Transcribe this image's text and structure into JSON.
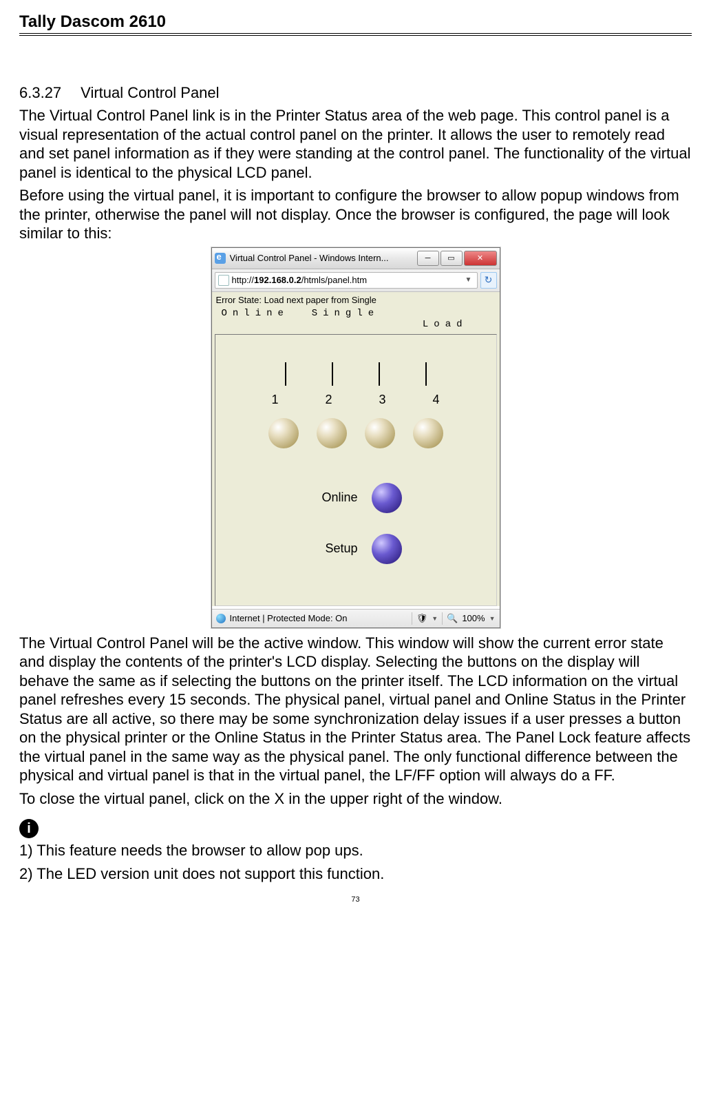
{
  "header": {
    "title": "Tally Dascom 2610"
  },
  "section": {
    "number": "6.3.27",
    "title": "Virtual Control Panel"
  },
  "para1": "The Virtual Control Panel link is in the Printer Status area of the web page. This control panel is a visual representation of the actual control panel on the printer. It allows the user to remotely read and set panel information as if they were standing at the control panel. The functionality of the virtual panel is identical to the physical LCD panel.",
  "para2": "Before using the virtual panel, it is important to configure the browser to allow popup windows from the printer, otherwise the panel will not display. Once the browser is configured, the page will look similar to this:",
  "window": {
    "title": "Virtual Control Panel - Windows Intern...",
    "url_prefix": "http://",
    "url_host": "192.168.0.2",
    "url_path": "/htmls/panel.htm",
    "error_state": "Error State: Load next paper from Single",
    "lcd_line1": "Online  Single",
    "lcd_line2": "Load",
    "numbers": [
      "1",
      "2",
      "3",
      "4"
    ],
    "online_label": "Online",
    "setup_label": "Setup",
    "status_text": "Internet | Protected Mode: On",
    "zoom": "100%"
  },
  "para3": "The Virtual Control Panel will be the active window. This window will show the current error state and display the contents of the printer's LCD display. Selecting the buttons on the display will behave the same as if selecting the buttons on the printer itself. The LCD information on the virtual panel refreshes every 15 seconds. The physical panel, virtual panel and Online Status in the Printer Status are all active, so there may be some synchronization delay issues if a user presses a button on the physical printer or the Online Status in the Printer Status area. The Panel Lock feature affects the virtual panel in the same way as the physical panel. The only functional difference between the physical and virtual panel is that in the virtual panel, the LF/FF option will always do a FF.",
  "para4": "To close the virtual panel, click on the X in the upper right of the window.",
  "note1": "1) This feature needs the browser to allow pop ups.",
  "note2": "2) The LED version unit does not support this function.",
  "page_number": "73"
}
